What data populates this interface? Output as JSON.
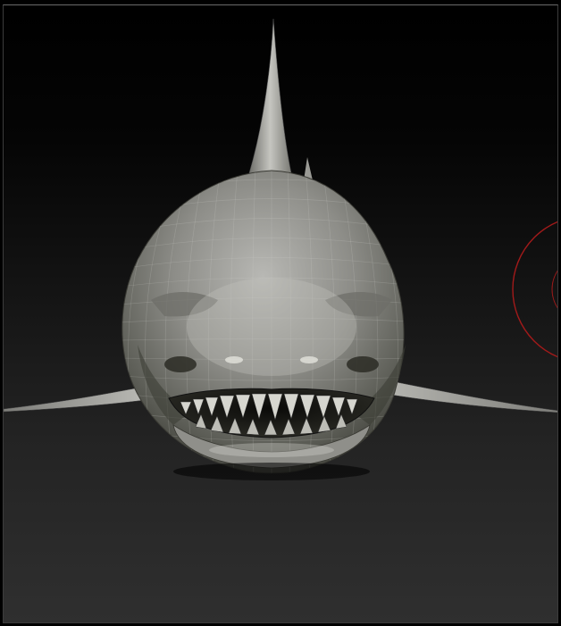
{
  "app": {
    "title": ""
  },
  "viewport": {
    "subject": "shark-sculpt-front-view",
    "display_mode": "wireframe-polyframe",
    "background_colors": [
      "#000000",
      "#2f2f2f"
    ]
  },
  "brush_cursor": {
    "color": "#a11a1a",
    "visible": true
  },
  "icons": {
    "brush": "brush-cursor-icon"
  }
}
